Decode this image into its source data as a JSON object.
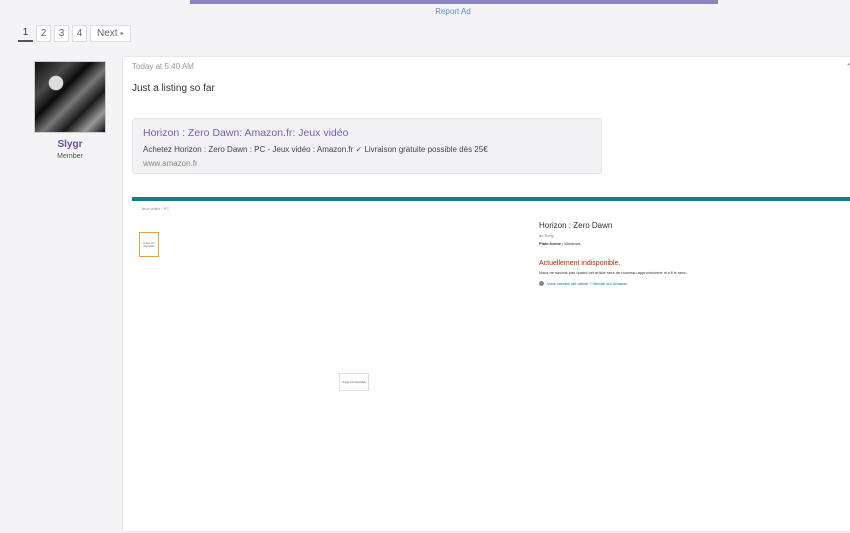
{
  "ad": {
    "report_label": "Report Ad"
  },
  "pagination": {
    "pages": [
      "1",
      "2",
      "3",
      "4"
    ],
    "next_label": "Next",
    "next_arrow": "▸"
  },
  "user": {
    "name": "Slygr",
    "role": "Member"
  },
  "post": {
    "timestamp": "Today at 5:40 AM",
    "text": "Just a listing so far",
    "menu_glyph": "•"
  },
  "link_preview": {
    "title": "Horizon : Zero Dawn: Amazon.fr: Jeux vidéo",
    "description": "Achetez Horizon : Zero Dawn : PC - Jeux vidéo : Amazon.fr ✓ Livraison gratuite possible dès 25€",
    "domain": "www.amazon.fr"
  },
  "embed": {
    "breadcrumb": "Jeux vidéo › PC",
    "thumb_text": "Image non disponible",
    "product_title": "Horizon : Zero Dawn",
    "brand": "de Sony",
    "platform_label": "Plate-forme",
    "platform_value": "Windows",
    "availability": "Actuellement indisponible.",
    "availability_note": "Nous ne savons pas quand cet article sera de nouveau approvisionné ni s'il le sera.",
    "sold_by": "Vous vendez cet article ? Vendre sur Amazon",
    "image_placeholder": "Image non disponible"
  }
}
